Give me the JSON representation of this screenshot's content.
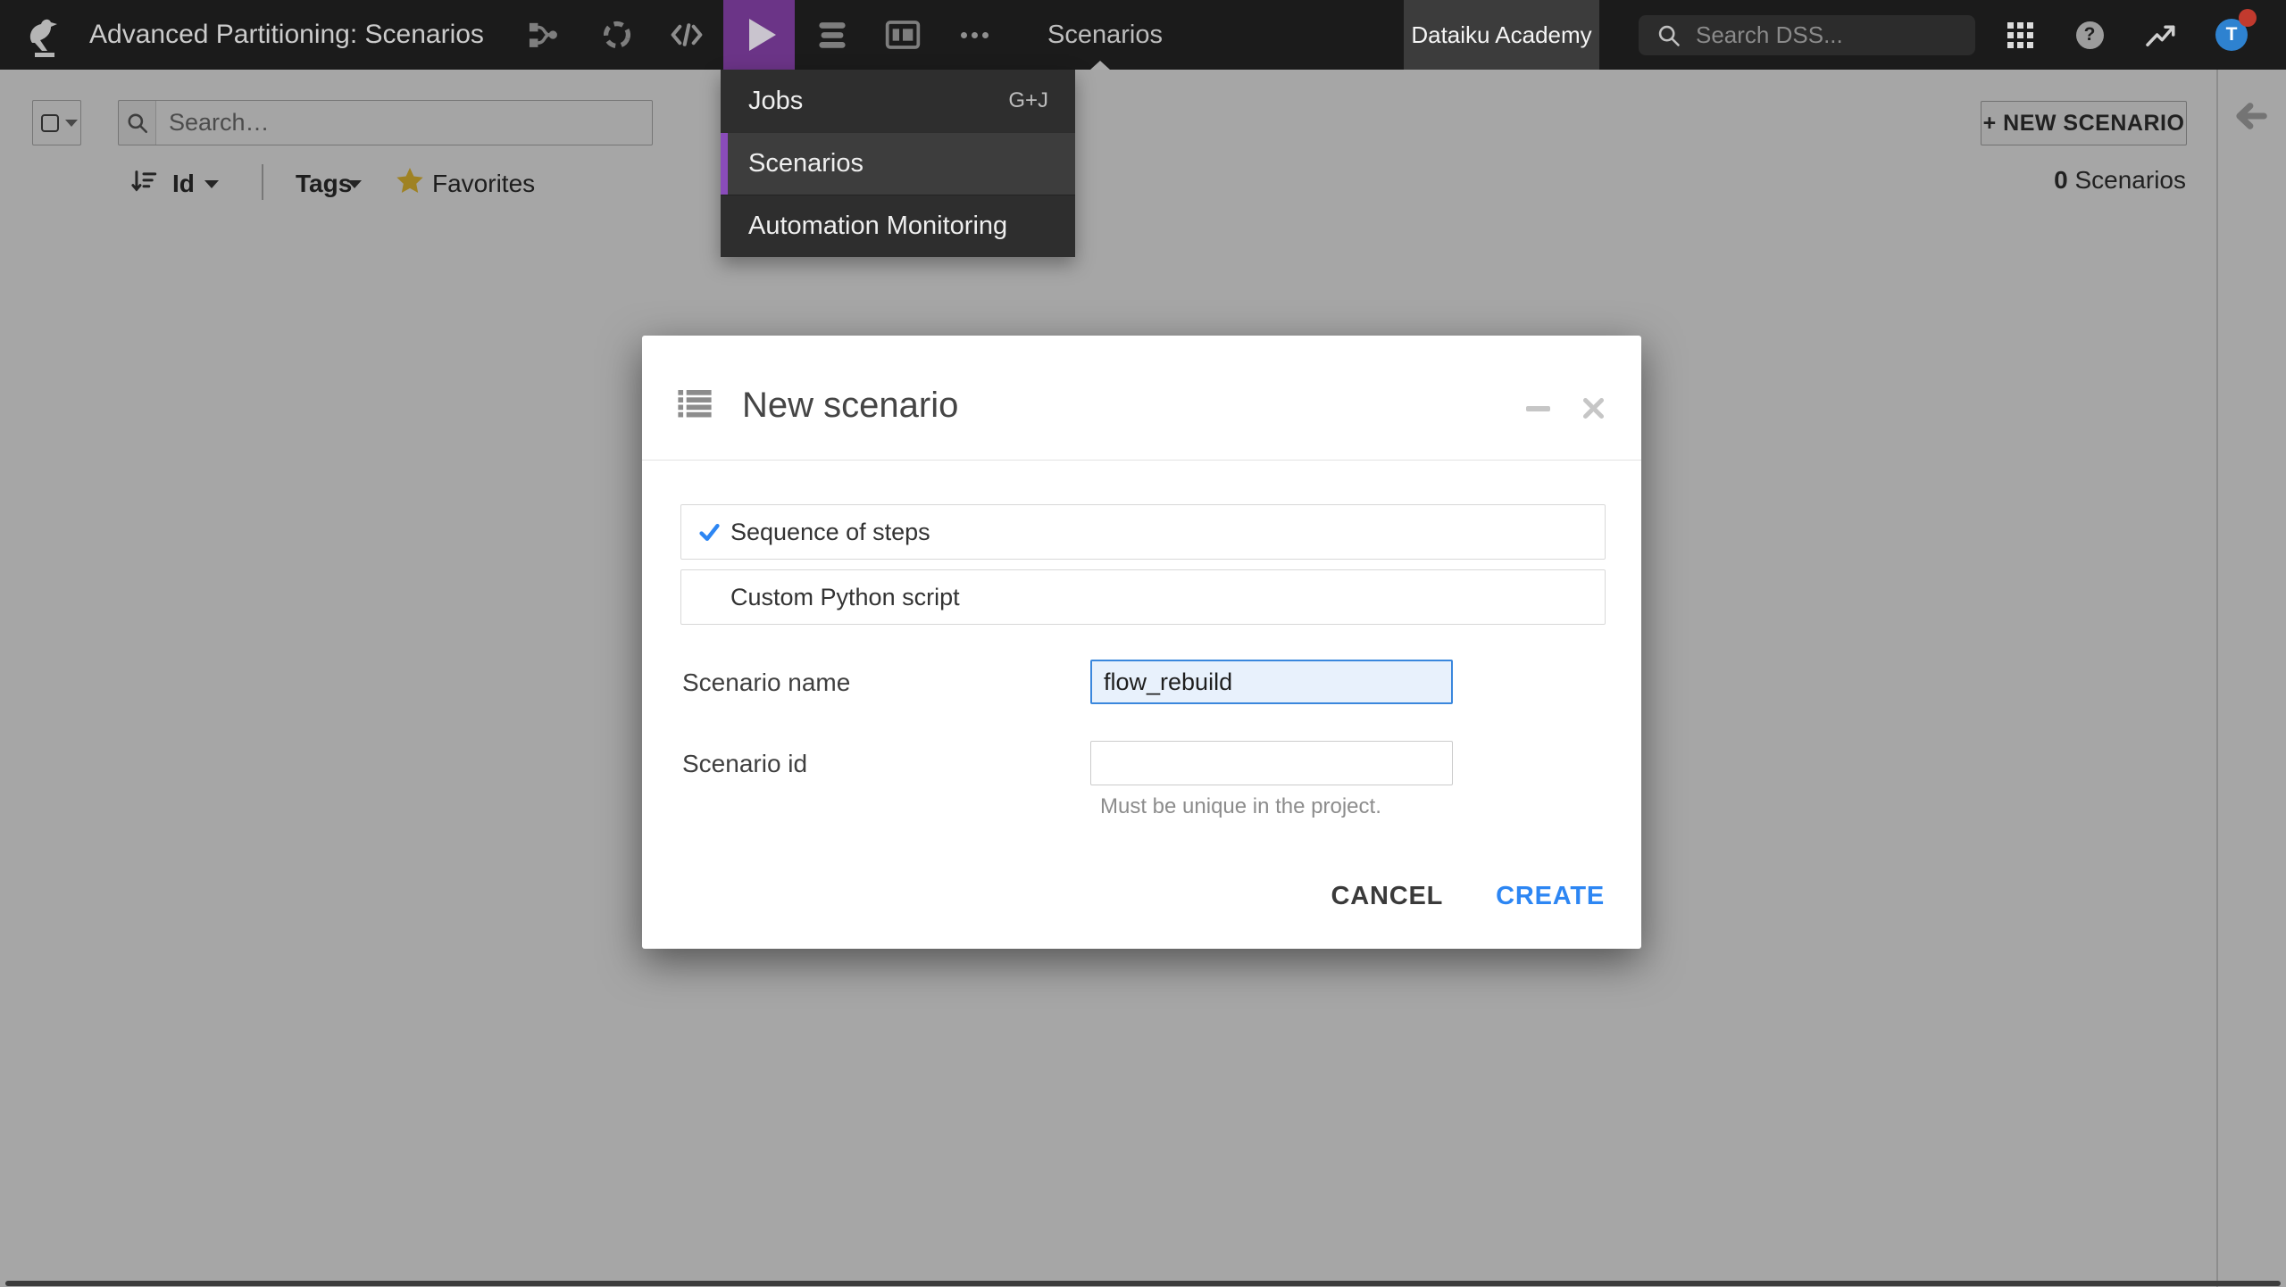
{
  "topbar": {
    "title": "Advanced Partitioning: Scenarios",
    "nav_current": "Scenarios",
    "academy_label": "Dataiku Academy",
    "search_placeholder": "Search DSS...",
    "help_glyph": "?",
    "avatar_initial": "T"
  },
  "nav_dropdown": {
    "items": [
      {
        "label": "Jobs",
        "shortcut": "G+J",
        "active": false
      },
      {
        "label": "Scenarios",
        "shortcut": "",
        "active": true
      },
      {
        "label": "Automation Monitoring",
        "shortcut": "",
        "active": false
      }
    ]
  },
  "toolbar": {
    "search_placeholder": "Search…",
    "sort_label": "Id",
    "tags_label": "Tags",
    "favorites_label": "Favorites",
    "new_scenario_button": "+ NEW SCENARIO",
    "count_value": "0",
    "count_label": "Scenarios"
  },
  "modal": {
    "title": "New scenario",
    "options": [
      {
        "label": "Sequence of steps",
        "selected": true
      },
      {
        "label": "Custom Python script",
        "selected": false
      }
    ],
    "name_label": "Scenario name",
    "name_value": "flow_rebuild",
    "id_label": "Scenario id",
    "id_value": "",
    "id_help": "Must be unique in the project.",
    "cancel_label": "CANCEL",
    "create_label": "CREATE"
  },
  "colors": {
    "topbar_bg": "#1b1b1b",
    "scenario_purple": "#6b3487",
    "menu_accent_purple": "#8a4cba",
    "accent_blue": "#2d86f3",
    "favorite_gold": "#f5c837",
    "avatar_blue": "#2e82d0",
    "notification_red": "#c23a2e"
  }
}
